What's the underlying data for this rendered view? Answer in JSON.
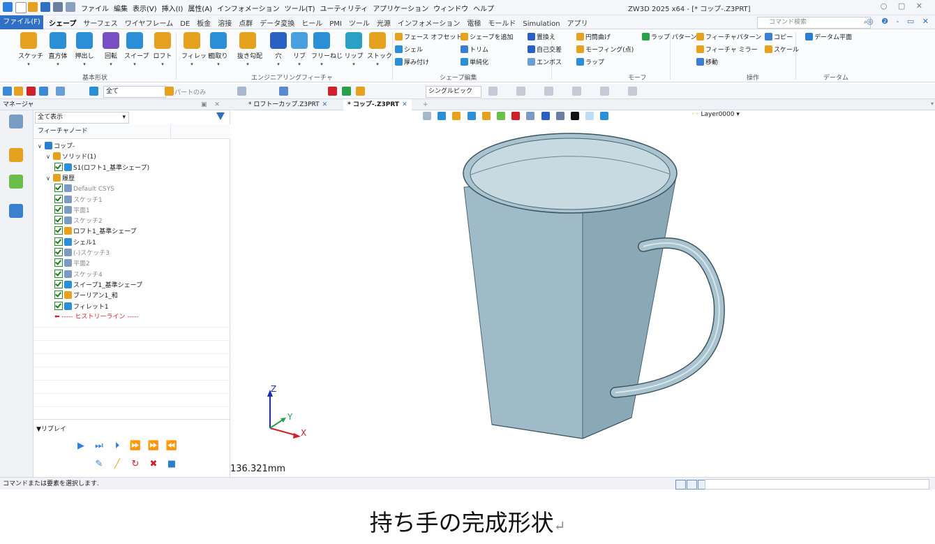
{
  "titlebar": {
    "menu": [
      "ファイル",
      "編集",
      "表示(V)",
      "挿入(I)",
      "属性(A)",
      "インフォメーション",
      "ツール(T)",
      "ユーティリティ",
      "アプリケーション",
      "ウィンドウ",
      "ヘルプ"
    ],
    "title": "ZW3D 2025 x64 - [* コップ-.Z3PRT]"
  },
  "tabrow": {
    "file": "ファイル(F)",
    "tabs": [
      "シェープ",
      "サーフェス",
      "ワイヤフレーム",
      "DE",
      "板金",
      "溶接",
      "点群",
      "データ変換",
      "ヒール",
      "PMI",
      "ツール",
      "光源",
      "インフォメーション",
      "電極",
      "モールド",
      "Simulation",
      "アプリ"
    ],
    "active_tab": "シェープ",
    "search_placeholder": "コマンド検索"
  },
  "ribbon": {
    "big_buttons": [
      {
        "label": "スケッチ",
        "color": "#e6a21f"
      },
      {
        "label": "直方体",
        "color": "#2a8fd6"
      },
      {
        "label": "押出し",
        "color": "#2a8fd6"
      },
      {
        "label": "回転",
        "color": "#7a4fc4"
      },
      {
        "label": "スイープ",
        "color": "#2a8fd6"
      },
      {
        "label": "ロフト",
        "color": "#e6a21f"
      },
      {
        "label": "フィレット",
        "color": "#e6a21f"
      },
      {
        "label": "面取り",
        "color": "#2a8fd6"
      },
      {
        "label": "抜き勾配",
        "color": "#e6a21f"
      },
      {
        "label": "穴",
        "color": "#2a5fc4"
      },
      {
        "label": "リブ",
        "color": "#4a9fe0"
      },
      {
        "label": "フリーねじ",
        "color": "#2a8fd6"
      },
      {
        "label": "リップ",
        "color": "#2aa0c4"
      },
      {
        "label": "ストック",
        "color": "#e6a21f"
      }
    ],
    "groups": [
      "基本形状",
      "エンジニアリングフィーチャ",
      "シェープ編集",
      "モーフ",
      "操作",
      "データム"
    ],
    "small_buttons": [
      "フェース オフセット",
      "シェル",
      "厚み付け",
      "シェープを追加",
      "トリム",
      "単純化",
      "置換え",
      "自己交差",
      "エンボス",
      "円筒曲げ",
      "モーフィング(点)",
      "ラップ",
      "ラップ パターン",
      "フィーチャパターン",
      "フィーチャ ミラー",
      "移動",
      "コピー",
      "スケール",
      "データム平面"
    ]
  },
  "toolbar2": {
    "filter": "全て",
    "part_only": "パートのみ",
    "pick_mode": "シングルピック"
  },
  "manager": {
    "title": "マネージャ",
    "filter": "全て表示",
    "column": "フィーチャノード",
    "nodes": [
      {
        "label": "コップ-",
        "indent": 0,
        "check": false,
        "dim": false,
        "color": "#2a7fd0"
      },
      {
        "label": "ソリッド(1)",
        "indent": 1,
        "check": false,
        "dim": false,
        "color": "#e6a21f"
      },
      {
        "label": "S1(ロフト1_基準シェープ)",
        "indent": 2,
        "check": true,
        "dim": false,
        "color": "#2a8fd6"
      },
      {
        "label": "履歴",
        "indent": 1,
        "check": false,
        "dim": false,
        "color": "#e6a21f"
      },
      {
        "label": "Default CSYS",
        "indent": 2,
        "check": true,
        "dim": true,
        "color": "#7a9bc4"
      },
      {
        "label": "スケッチ1",
        "indent": 2,
        "check": true,
        "dim": true,
        "color": "#7a9bc4"
      },
      {
        "label": "平面1",
        "indent": 2,
        "check": true,
        "dim": true,
        "color": "#7a9bc4"
      },
      {
        "label": "スケッチ2",
        "indent": 2,
        "check": true,
        "dim": true,
        "color": "#7a9bc4"
      },
      {
        "label": "ロフト1_基準シェープ",
        "indent": 2,
        "check": true,
        "dim": false,
        "color": "#e6a21f"
      },
      {
        "label": "シェル1",
        "indent": 2,
        "check": true,
        "dim": false,
        "color": "#2a8fd6"
      },
      {
        "label": "(-)スケッチ3",
        "indent": 2,
        "check": true,
        "dim": true,
        "color": "#7a9bc4"
      },
      {
        "label": "平面2",
        "indent": 2,
        "check": true,
        "dim": true,
        "color": "#7a9bc4"
      },
      {
        "label": "スケッチ4",
        "indent": 2,
        "check": true,
        "dim": true,
        "color": "#7a9bc4"
      },
      {
        "label": "スイープ1_基準シェープ",
        "indent": 2,
        "check": true,
        "dim": false,
        "color": "#2a8fd6"
      },
      {
        "label": "ブーリアン1_和",
        "indent": 2,
        "check": true,
        "dim": false,
        "color": "#e6a21f"
      },
      {
        "label": "フィレット1",
        "indent": 2,
        "check": true,
        "dim": false,
        "color": "#2a8fd6"
      },
      {
        "label": "----- ヒストリーライン -----",
        "indent": 2,
        "check": false,
        "dim": false,
        "history": true,
        "color": "#d0202a"
      }
    ],
    "replay": "▼リプレイ"
  },
  "doctabs": [
    {
      "label": "* ロフトーカップ.Z3PRT",
      "active": false
    },
    {
      "label": "* コップ-.Z3PRT",
      "active": true
    }
  ],
  "viewport": {
    "layer": "Layer0000",
    "scale": "136.321mm",
    "axes": {
      "x": "X",
      "y": "Y",
      "z": "Z"
    },
    "model_color": "#a7c2cf"
  },
  "status": {
    "text": "コマンドまたは要素を選択します."
  },
  "caption": {
    "text": "持ち手の完成形状",
    "mark": "↵"
  }
}
